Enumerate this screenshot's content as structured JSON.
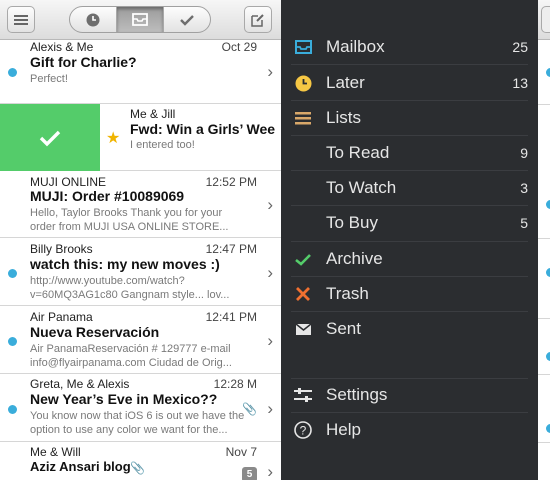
{
  "toolbar": {
    "menu_icon": "hamburger-icon",
    "segments": [
      {
        "icon": "clock-icon",
        "active": false
      },
      {
        "icon": "inbox-tray-icon",
        "active": true
      },
      {
        "icon": "checkmark-icon",
        "active": false
      }
    ],
    "compose_icon": "compose-icon"
  },
  "messages": [
    {
      "from": "Alexis & Me",
      "time": "Oct 29",
      "subject": "Gift for Charlie?",
      "preview1": "Perfect!",
      "preview2": "",
      "unread": true
    },
    {
      "from": "MUJI ONLINE",
      "time": "12:52 PM",
      "subject": "MUJI: Order #10089069",
      "preview1": "Hello, Taylor Brooks Thank you for your",
      "preview2": "order from MUJI USA ONLINE STORE...",
      "unread": false
    },
    {
      "from": "Billy Brooks",
      "time": "12:47 PM",
      "subject": "watch this: my new moves :)",
      "preview1": "http://www.youtube.com/watch?",
      "preview2": "v=60MQ3AG1c80 Gangnam style... lov...",
      "unread": true
    },
    {
      "from": "Air Panama",
      "time": "12:41 PM",
      "subject": "Nueva Reservación",
      "preview1": "Air PanamaReservación # 129777 e-mail",
      "preview2": "info@flyairpanama.com Ciudad de Orig...",
      "unread": true
    },
    {
      "from": "Greta, Me & Alexis",
      "time": "12:28 M",
      "subject": "New Year’s Eve in Mexico??",
      "preview1": "You know now that iOS 6 is out we have the",
      "preview2": "option to use any color we want for the...",
      "unread": true,
      "attachment": true
    },
    {
      "from": "Me & Will",
      "time": "Nov 7",
      "subject": "Aziz Ansari blog",
      "preview1": "",
      "preview2": "",
      "unread": false,
      "attachment": true,
      "count": "5"
    }
  ],
  "swiped_message": {
    "from": "Me & Jill",
    "subject": "Fwd: Win a Girls’ Wee",
    "preview": "I entered too!",
    "starred": true
  },
  "sidebar": {
    "items": [
      {
        "label": "Mailbox",
        "count": "25",
        "icon": "inbox-tray-icon",
        "color": "#3aaddb"
      },
      {
        "label": "Later",
        "count": "13",
        "icon": "clock-icon",
        "color": "#f6c744"
      },
      {
        "label": "Lists",
        "count": "",
        "icon": "list-icon",
        "color": "#d9a86a"
      },
      {
        "label": "To Read",
        "count": "9",
        "icon": "",
        "color": ""
      },
      {
        "label": "To Watch",
        "count": "3",
        "icon": "",
        "color": ""
      },
      {
        "label": "To Buy",
        "count": "5",
        "icon": "",
        "color": ""
      },
      {
        "label": "Archive",
        "count": "",
        "icon": "checkmark-icon",
        "color": "#54cc6a"
      },
      {
        "label": "Trash",
        "count": "",
        "icon": "x-icon",
        "color": "#f07030"
      },
      {
        "label": "Sent",
        "count": "",
        "icon": "envelope-icon",
        "color": "#e6e6e6"
      }
    ],
    "settings_label": "Settings",
    "help_label": "Help"
  }
}
